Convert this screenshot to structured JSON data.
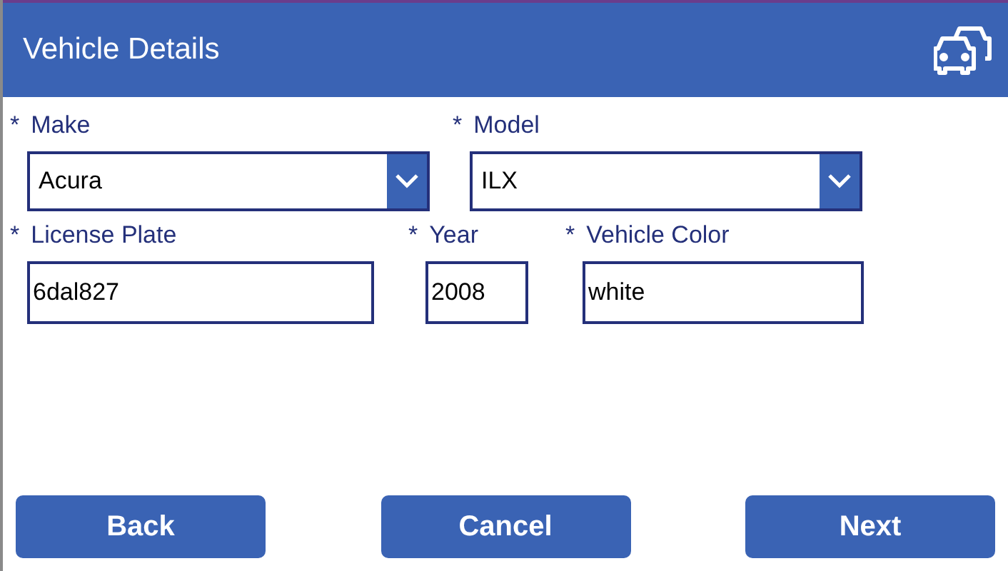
{
  "header": {
    "title": "Vehicle Details"
  },
  "rows": [
    {
      "fields": [
        {
          "kind": "dropdown",
          "required_mark": "*",
          "label": "Make",
          "value": "Acura"
        },
        {
          "kind": "dropdown",
          "required_mark": "*",
          "label": "Model",
          "value": "ILX"
        }
      ]
    },
    {
      "fields": [
        {
          "kind": "text",
          "required_mark": "*",
          "label": "License Plate",
          "value": "6dal827"
        },
        {
          "kind": "text",
          "required_mark": "*",
          "label": "Year",
          "value": "2008"
        },
        {
          "kind": "text",
          "required_mark": "*",
          "label": "Vehicle Color",
          "value": "white"
        }
      ]
    }
  ],
  "buttons": [
    "Back",
    "Cancel",
    "Next"
  ]
}
